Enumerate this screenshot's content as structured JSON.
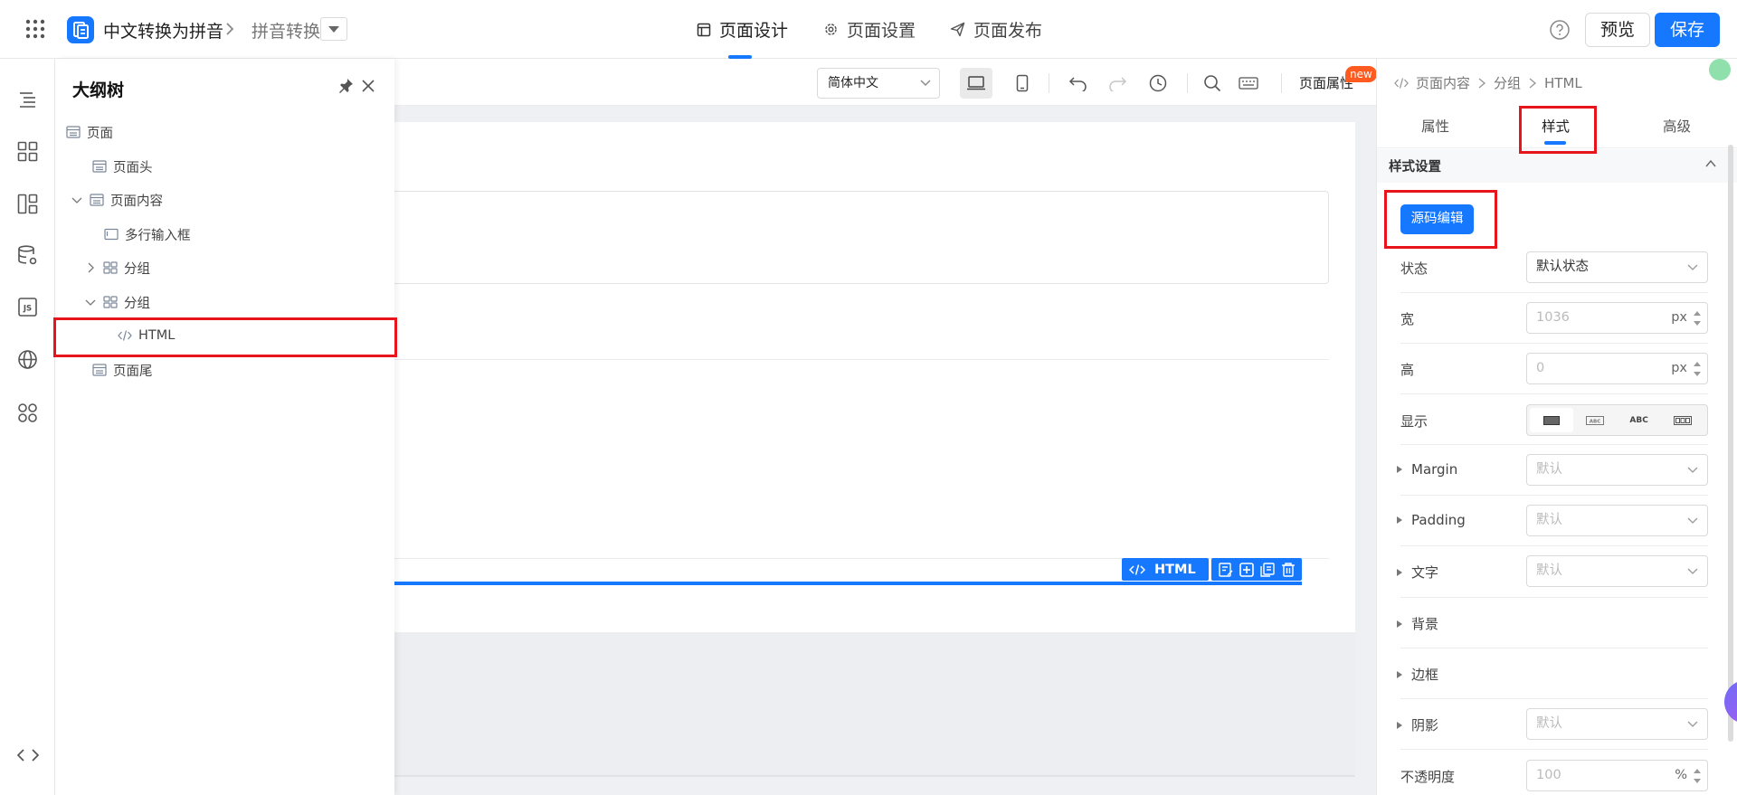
{
  "header": {
    "app_name": "中文转换为拼音",
    "page_name": "拼音转换",
    "tabs": [
      {
        "label": "页面设计",
        "active": true
      },
      {
        "label": "页面设置",
        "active": false
      },
      {
        "label": "页面发布",
        "active": false
      }
    ],
    "preview_label": "预览",
    "save_label": "保存"
  },
  "outline": {
    "title": "大纲树",
    "nodes": [
      {
        "label": "页面",
        "type": "page"
      },
      {
        "label": "页面头",
        "type": "block"
      },
      {
        "label": "页面内容",
        "type": "block",
        "expanded": true
      },
      {
        "label": "多行输入框",
        "type": "textarea"
      },
      {
        "label": "分组",
        "type": "group",
        "expanded": false
      },
      {
        "label": "分组",
        "type": "group",
        "expanded": true
      },
      {
        "label": "HTML",
        "type": "html",
        "selected": true
      },
      {
        "label": "页面尾",
        "type": "block"
      }
    ]
  },
  "toolbar": {
    "language": "简体中文",
    "page_attr_label": "页面属性",
    "new_badge": "new"
  },
  "canvas": {
    "html_tag_label": "HTML"
  },
  "right_panel": {
    "breadcrumb": [
      "页面内容",
      "分组",
      "HTML"
    ],
    "tabs": [
      {
        "label": "属性",
        "active": false
      },
      {
        "label": "样式",
        "active": true
      },
      {
        "label": "高级",
        "active": false
      }
    ],
    "section_title": "样式设置",
    "source_edit_label": "源码编辑",
    "props": {
      "state": {
        "label": "状态",
        "value": "默认状态"
      },
      "width": {
        "label": "宽",
        "placeholder": "1036",
        "unit": "px"
      },
      "height": {
        "label": "高",
        "placeholder": "0",
        "unit": "px"
      },
      "display": {
        "label": "显示",
        "options": [
          "ABC",
          "ABC"
        ]
      },
      "margin": {
        "label": "Margin",
        "value": "默认"
      },
      "padding": {
        "label": "Padding",
        "value": "默认"
      },
      "text": {
        "label": "文字",
        "value": "默认"
      },
      "background": {
        "label": "背景"
      },
      "border": {
        "label": "边框"
      },
      "shadow": {
        "label": "阴影",
        "value": "默认"
      },
      "opacity": {
        "label": "不透明度",
        "placeholder": "100",
        "unit": "%"
      }
    }
  },
  "colors": {
    "primary": "#1677ff",
    "highlight_box": "#e8141b",
    "new_badge": "#ff5a1f"
  }
}
